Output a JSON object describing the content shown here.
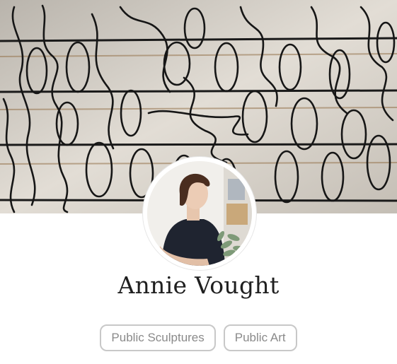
{
  "profile": {
    "name": "Annie Vought",
    "cover_image": "wire-sculpture-cover-image",
    "avatar_image": "profile-photo"
  },
  "tags": [
    {
      "label": "Public Sculptures"
    },
    {
      "label": "Public Art"
    }
  ],
  "colors": {
    "name_text": "#1f1f1f",
    "tag_border": "#c8c8c8",
    "tag_text": "#8a8a8a",
    "background": "#ffffff"
  }
}
